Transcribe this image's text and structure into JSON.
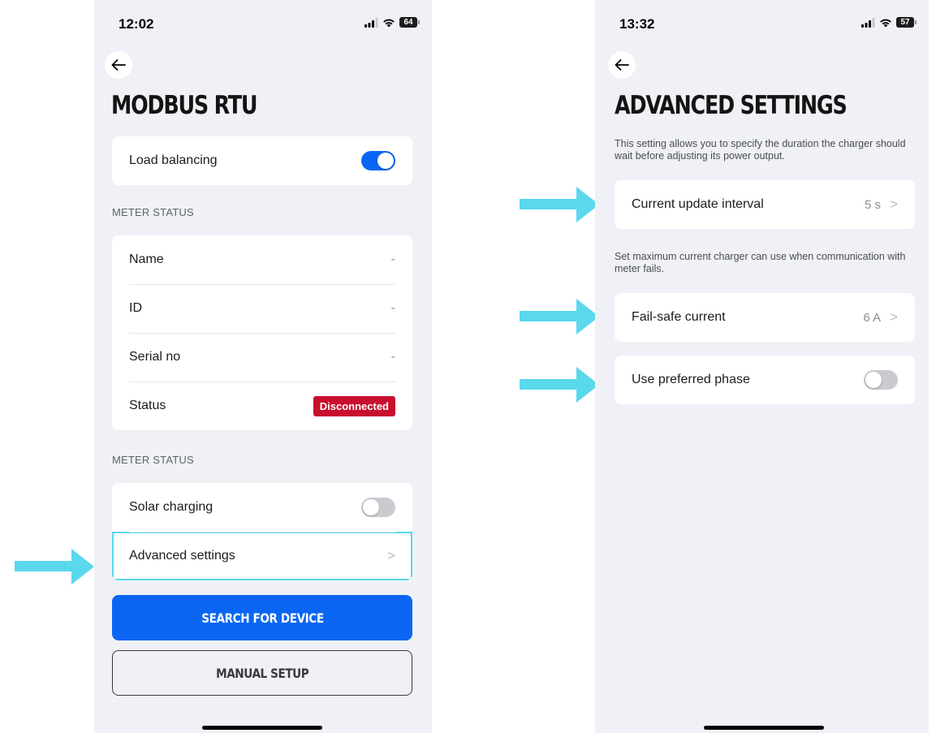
{
  "left_screen": {
    "status_time": "12:02",
    "battery": "64",
    "title": "MODBUS RTU",
    "load_balancing": {
      "label": "Load balancing",
      "enabled": true
    },
    "meter_status_section": "METER STATUS",
    "meter_rows": [
      {
        "label": "Name",
        "value": "-"
      },
      {
        "label": "ID",
        "value": "-"
      },
      {
        "label": "Serial no",
        "value": "-"
      }
    ],
    "status_row": {
      "label": "Status",
      "badge": "Disconnected"
    },
    "second_section": "METER STATUS",
    "solar_charging": {
      "label": "Solar charging",
      "enabled": false
    },
    "advanced_settings": {
      "label": "Advanced settings",
      "chevron": ">"
    },
    "search_button": "SEARCH FOR DEVICE",
    "manual_button": "MANUAL SETUP"
  },
  "right_screen": {
    "status_time": "13:32",
    "battery": "57",
    "title": "ADVANCED SETTINGS",
    "desc_interval": "This setting allows you to specify the duration the charger should wait before adjusting its power output.",
    "update_interval": {
      "label": "Current update interval",
      "value": "5 s",
      "chevron": ">"
    },
    "desc_failsafe": "Set maximum current charger can use when communication with meter fails.",
    "failsafe": {
      "label": "Fail-safe current",
      "value": "6 A",
      "chevron": ">"
    },
    "preferred_phase": {
      "label": "Use preferred phase",
      "enabled": false
    }
  },
  "colors": {
    "accent": "#0a66f2",
    "badge": "#c8102e",
    "annotation_arrow": "#5ad8ec",
    "screen_bg": "#eff1f6"
  },
  "icons": {
    "back": "back-arrow-icon",
    "signal": "signal-icon",
    "wifi": "wifi-icon",
    "battery": "battery-icon",
    "chevron": "chevron-right-icon",
    "annotation": "annotation-arrow-icon"
  }
}
